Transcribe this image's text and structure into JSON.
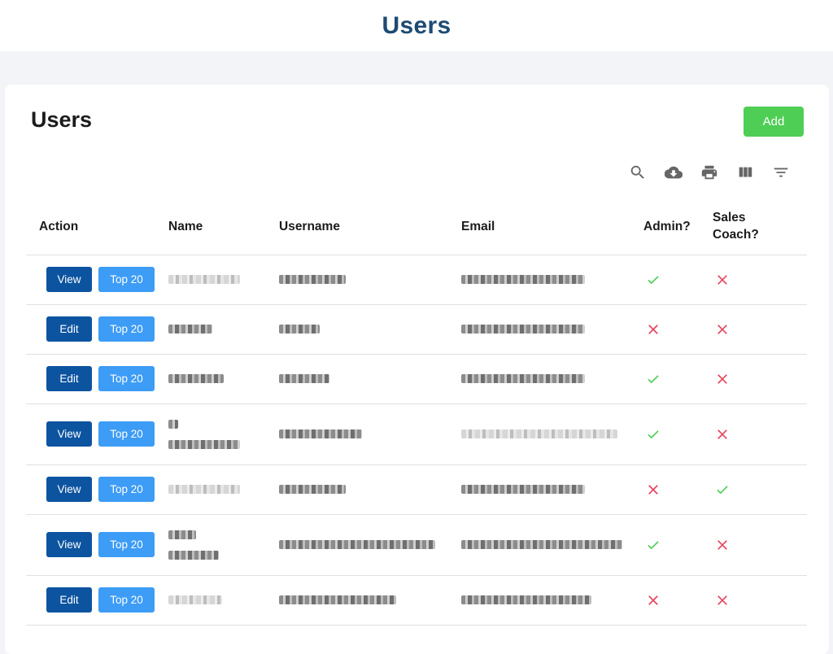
{
  "header": {
    "title": "Users"
  },
  "card": {
    "title": "Users",
    "add_label": "Add"
  },
  "toolbar": {
    "icons": [
      "search-icon",
      "cloud-download-icon",
      "print-icon",
      "view-column-icon",
      "filter-list-icon"
    ]
  },
  "table": {
    "columns": [
      "Action",
      "Name",
      "Username",
      "Email",
      "Admin?",
      "Sales\nCoach?"
    ],
    "top_label": "Top 20",
    "rows": [
      {
        "action": "View",
        "admin": true,
        "sales_coach": false
      },
      {
        "action": "Edit",
        "admin": false,
        "sales_coach": false
      },
      {
        "action": "Edit",
        "admin": true,
        "sales_coach": false
      },
      {
        "action": "View",
        "admin": true,
        "sales_coach": false
      },
      {
        "action": "View",
        "admin": false,
        "sales_coach": true
      },
      {
        "action": "View",
        "admin": true,
        "sales_coach": false
      },
      {
        "action": "Edit",
        "admin": false,
        "sales_coach": false
      }
    ]
  },
  "colors": {
    "header_title": "#1d4b73",
    "add": "#4fce56",
    "primary": "#0d54a0",
    "top20": "#3d9cf5",
    "check": "#4fce56",
    "cross": "#e5455d"
  }
}
